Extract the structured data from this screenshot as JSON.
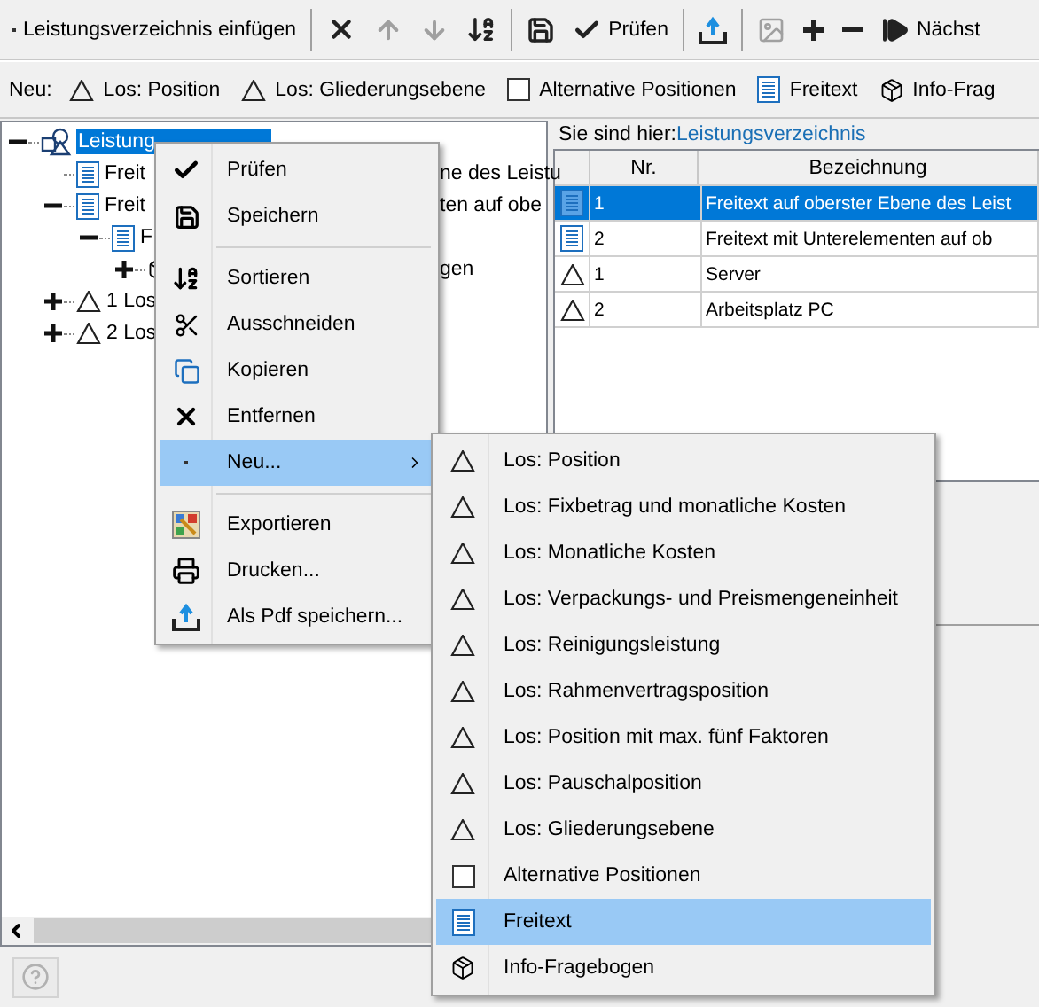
{
  "toolbar": {
    "groups": [
      [
        {
          "label": "Leistungsverzeichnis einfügen",
          "disabled": false
        }
      ],
      [
        {
          "disabled": false
        },
        {
          "disabled": true
        },
        {
          "disabled": true
        },
        {
          "disabled": false
        }
      ],
      [
        {
          "disabled": false
        },
        {
          "label": "Prüfen",
          "disabled": false
        }
      ],
      [
        {
          "disabled": false
        }
      ],
      [
        {
          "disabled": true
        },
        {
          "disabled": false
        },
        {
          "disabled": false
        },
        {
          "label": "Nächst",
          "disabled": false
        }
      ]
    ]
  },
  "new_bar": {
    "label": "Neu:",
    "items": [
      {
        "kind": "lot",
        "label": "Los: Position"
      },
      {
        "kind": "lot",
        "label": "Los: Gliederungsebene"
      },
      {
        "kind": "alternative",
        "label": "Alternative Positionen"
      },
      {
        "kind": "freetext",
        "label": "Freitext"
      },
      {
        "kind": "questionnaire",
        "label": "Info-Frag"
      }
    ]
  },
  "tree": [
    {
      "kind": "root",
      "label": "Leistung",
      "selected": true,
      "expanded": true,
      "children": [
        {
          "kind": "freetext",
          "label": "Freit",
          "tail": "ne des Leistu",
          "selected": false
        },
        {
          "kind": "freetext",
          "label": "Freit",
          "tail": "ten auf obe",
          "selected": false,
          "expanded": true,
          "children": [
            {
              "kind": "freetext",
              "label": "F",
              "selected": false,
              "expanded": true,
              "children": [
                {
                  "kind": "questionnaire",
                  "tail": "gen",
                  "expanded": false
                }
              ]
            }
          ]
        },
        {
          "kind": "lot",
          "label": "1 Los",
          "selected": false,
          "expanded": false
        },
        {
          "kind": "lot",
          "label": "2 Los",
          "selected": false,
          "expanded": false
        }
      ]
    }
  ],
  "breadcrumb": {
    "label": "Sie sind hier:",
    "link": "Leistungsverzeichnis"
  },
  "table": {
    "columns": [
      "Nr.",
      "Bezeichnung"
    ],
    "rows": [
      {
        "kind": "freetext",
        "nr": "1",
        "name": "Freitext auf oberster Ebene des Leist",
        "selected": true
      },
      {
        "kind": "freetext",
        "nr": "2",
        "name": "Freitext mit Unterelementen auf ob",
        "selected": false
      },
      {
        "kind": "lot",
        "nr": "1",
        "name": "Server",
        "selected": false
      },
      {
        "kind": "lot",
        "nr": "2",
        "name": "Arbeitsplatz PC",
        "selected": false
      }
    ]
  },
  "context_menu": {
    "groups": [
      [
        {
          "label": "Prüfen",
          "selected": false,
          "has_submenu": false
        },
        {
          "label": "Speichern",
          "selected": false,
          "has_submenu": false
        }
      ],
      [
        {
          "label": "Sortieren",
          "selected": false,
          "has_submenu": false
        },
        {
          "label": "Ausschneiden",
          "selected": false,
          "has_submenu": false
        },
        {
          "label": "Kopieren",
          "selected": false,
          "has_submenu": false
        },
        {
          "label": "Entfernen",
          "selected": false,
          "has_submenu": false
        },
        {
          "label": "Neu...",
          "selected": true,
          "has_submenu": true
        }
      ],
      [
        {
          "label": "Exportieren",
          "selected": false,
          "has_submenu": false
        },
        {
          "label": "Drucken...",
          "selected": false,
          "has_submenu": false
        },
        {
          "label": "Als Pdf speichern...",
          "selected": false,
          "has_submenu": false
        }
      ]
    ]
  },
  "submenu": {
    "items": [
      {
        "kind": "lot",
        "label": "Los: Position",
        "selected": false
      },
      {
        "kind": "lot",
        "label": "Los: Fixbetrag und monatliche Kosten",
        "selected": false
      },
      {
        "kind": "lot",
        "label": "Los: Monatliche Kosten",
        "selected": false
      },
      {
        "kind": "lot",
        "label": "Los: Verpackungs- und Preismengeneinheit",
        "selected": false
      },
      {
        "kind": "lot",
        "label": "Los: Reinigungsleistung",
        "selected": false
      },
      {
        "kind": "lot",
        "label": "Los: Rahmenvertragsposition",
        "selected": false
      },
      {
        "kind": "lot",
        "label": "Los: Position mit max. fünf Faktoren",
        "selected": false
      },
      {
        "kind": "lot",
        "label": "Los: Pauschalposition",
        "selected": false
      },
      {
        "kind": "lot",
        "label": "Los: Gliederungsebene",
        "selected": false
      },
      {
        "kind": "alternative",
        "label": "Alternative Positionen",
        "selected": false
      },
      {
        "kind": "freetext",
        "label": "Freitext",
        "selected": true
      },
      {
        "kind": "questionnaire",
        "label": "Info-Fragebogen",
        "selected": false
      }
    ]
  },
  "status_bar": {
    "help_disabled": true
  }
}
